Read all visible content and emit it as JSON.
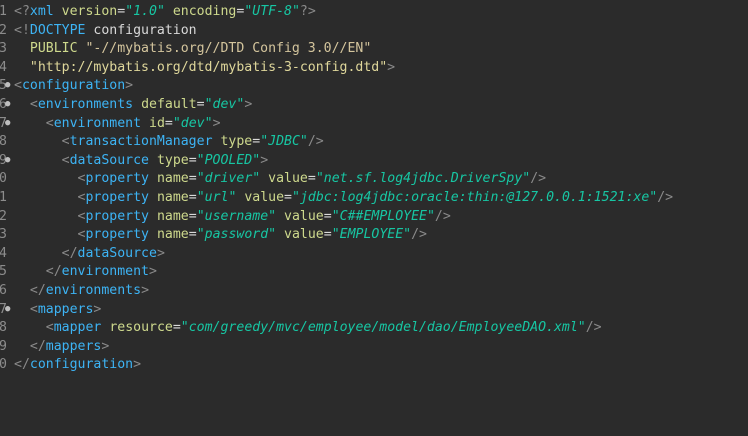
{
  "editor": {
    "lines": [
      {
        "ln": "1",
        "segs": [
          [
            "br",
            "<?"
          ],
          [
            "tag",
            "xml"
          ],
          [
            "kw",
            " "
          ],
          [
            "attr",
            "version"
          ],
          [
            "eq",
            "="
          ],
          [
            "val",
            "\"1.0\""
          ],
          [
            "kw",
            " "
          ],
          [
            "attr",
            "encoding"
          ],
          [
            "eq",
            "="
          ],
          [
            "val",
            "\"UTF-8\""
          ],
          [
            "br",
            "?>"
          ]
        ]
      },
      {
        "ln": "2",
        "segs": [
          [
            "br",
            "<!"
          ],
          [
            "tag",
            "DOCTYPE"
          ],
          [
            "doct",
            " configuration"
          ]
        ]
      },
      {
        "ln": "3",
        "segs": [
          [
            "kw",
            "  "
          ],
          [
            "attr",
            "PUBLIC"
          ],
          [
            "kw",
            " "
          ],
          [
            "pubid",
            "\"-//mybatis.org//DTD Config 3.0//EN\""
          ]
        ]
      },
      {
        "ln": "4",
        "segs": [
          [
            "kw",
            "  "
          ],
          [
            "str",
            "\"http://mybatis.org/dtd/mybatis-3-config.dtd\""
          ],
          [
            "br",
            ">"
          ]
        ]
      },
      {
        "ln": "5",
        "fold": true,
        "segs": [
          [
            "br",
            "<"
          ],
          [
            "tag",
            "configuration"
          ],
          [
            "br",
            ">"
          ]
        ]
      },
      {
        "ln": "6",
        "fold": true,
        "segs": [
          [
            "kw",
            "  "
          ],
          [
            "br",
            "<"
          ],
          [
            "tag",
            "environments"
          ],
          [
            "kw",
            " "
          ],
          [
            "attr",
            "default"
          ],
          [
            "eq",
            "="
          ],
          [
            "val",
            "\"dev\""
          ],
          [
            "br",
            ">"
          ]
        ]
      },
      {
        "ln": "7",
        "fold": true,
        "segs": [
          [
            "kw",
            "    "
          ],
          [
            "br",
            "<"
          ],
          [
            "tag",
            "environment"
          ],
          [
            "kw",
            " "
          ],
          [
            "attr",
            "id"
          ],
          [
            "eq",
            "="
          ],
          [
            "val",
            "\"dev\""
          ],
          [
            "br",
            ">"
          ]
        ]
      },
      {
        "ln": "8",
        "segs": [
          [
            "kw",
            "      "
          ],
          [
            "br",
            "<"
          ],
          [
            "tag",
            "transactionManager"
          ],
          [
            "kw",
            " "
          ],
          [
            "attr",
            "type"
          ],
          [
            "eq",
            "="
          ],
          [
            "val",
            "\"JDBC\""
          ],
          [
            "br",
            "/>"
          ]
        ]
      },
      {
        "ln": "9",
        "fold": true,
        "segs": [
          [
            "kw",
            "      "
          ],
          [
            "br",
            "<"
          ],
          [
            "tag",
            "dataSource"
          ],
          [
            "kw",
            " "
          ],
          [
            "attr",
            "type"
          ],
          [
            "eq",
            "="
          ],
          [
            "val",
            "\"POOLED\""
          ],
          [
            "br",
            ">"
          ]
        ]
      },
      {
        "ln": "0",
        "segs": [
          [
            "kw",
            "        "
          ],
          [
            "br",
            "<"
          ],
          [
            "tag",
            "property"
          ],
          [
            "kw",
            " "
          ],
          [
            "attr",
            "name"
          ],
          [
            "eq",
            "="
          ],
          [
            "val",
            "\"driver\""
          ],
          [
            "kw",
            " "
          ],
          [
            "attr",
            "value"
          ],
          [
            "eq",
            "="
          ],
          [
            "val",
            "\"net.sf.log4jdbc.DriverSpy\""
          ],
          [
            "br",
            "/>"
          ]
        ]
      },
      {
        "ln": "1",
        "segs": [
          [
            "kw",
            "        "
          ],
          [
            "br",
            "<"
          ],
          [
            "tag",
            "property"
          ],
          [
            "kw",
            " "
          ],
          [
            "attr",
            "name"
          ],
          [
            "eq",
            "="
          ],
          [
            "val",
            "\"url\""
          ],
          [
            "kw",
            " "
          ],
          [
            "attr",
            "value"
          ],
          [
            "eq",
            "="
          ],
          [
            "val",
            "\"jdbc:log4jdbc:oracle:thin:@127.0.0.1:1521:xe\""
          ],
          [
            "br",
            "/>"
          ]
        ]
      },
      {
        "ln": "2",
        "segs": [
          [
            "kw",
            "        "
          ],
          [
            "br",
            "<"
          ],
          [
            "tag",
            "property"
          ],
          [
            "kw",
            " "
          ],
          [
            "attr",
            "name"
          ],
          [
            "eq",
            "="
          ],
          [
            "val",
            "\"username\""
          ],
          [
            "kw",
            " "
          ],
          [
            "attr",
            "value"
          ],
          [
            "eq",
            "="
          ],
          [
            "val",
            "\"C##EMPLOYEE\""
          ],
          [
            "br",
            "/>"
          ]
        ]
      },
      {
        "ln": "3",
        "segs": [
          [
            "kw",
            "        "
          ],
          [
            "br",
            "<"
          ],
          [
            "tag",
            "property"
          ],
          [
            "kw",
            " "
          ],
          [
            "attr",
            "name"
          ],
          [
            "eq",
            "="
          ],
          [
            "val",
            "\"password\""
          ],
          [
            "kw",
            " "
          ],
          [
            "attr",
            "value"
          ],
          [
            "eq",
            "="
          ],
          [
            "val",
            "\"EMPLOYEE\""
          ],
          [
            "br",
            "/>"
          ]
        ]
      },
      {
        "ln": "4",
        "segs": [
          [
            "kw",
            "      "
          ],
          [
            "br",
            "</"
          ],
          [
            "tag",
            "dataSource"
          ],
          [
            "br",
            ">"
          ]
        ]
      },
      {
        "ln": "5",
        "segs": [
          [
            "kw",
            "    "
          ],
          [
            "br",
            "</"
          ],
          [
            "tag",
            "environment"
          ],
          [
            "br",
            ">"
          ]
        ]
      },
      {
        "ln": "6",
        "segs": [
          [
            "kw",
            "  "
          ],
          [
            "br",
            "</"
          ],
          [
            "tag",
            "environments"
          ],
          [
            "br",
            ">"
          ]
        ]
      },
      {
        "ln": "7",
        "fold": true,
        "segs": [
          [
            "kw",
            "  "
          ],
          [
            "br",
            "<"
          ],
          [
            "tag",
            "mappers"
          ],
          [
            "br",
            ">"
          ]
        ]
      },
      {
        "ln": "8",
        "segs": [
          [
            "kw",
            "    "
          ],
          [
            "br",
            "<"
          ],
          [
            "tag",
            "mapper"
          ],
          [
            "kw",
            " "
          ],
          [
            "attr",
            "resource"
          ],
          [
            "eq",
            "="
          ],
          [
            "val",
            "\"com/greedy/mvc/employee/model/dao/EmployeeDAO.xml\""
          ],
          [
            "br",
            "/>"
          ]
        ]
      },
      {
        "ln": "9",
        "segs": [
          [
            "kw",
            "  "
          ],
          [
            "br",
            "</"
          ],
          [
            "tag",
            "mappers"
          ],
          [
            "br",
            ">"
          ]
        ]
      },
      {
        "ln": "0",
        "segs": [
          [
            "br",
            "</"
          ],
          [
            "tag",
            "configuration"
          ],
          [
            "br",
            ">"
          ]
        ]
      }
    ]
  },
  "colors": {
    "background": "#2b2b2b",
    "tag": "#3db4f5",
    "attribute": "#ced98d",
    "value": "#17c6a3",
    "bracket": "#8a8a8a"
  }
}
